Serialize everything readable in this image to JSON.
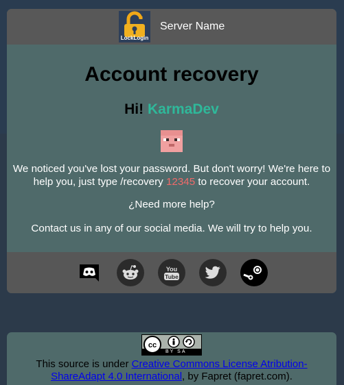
{
  "header": {
    "logo_text": "LockLogin",
    "server_name": "Server Name"
  },
  "main": {
    "title": "Account recovery",
    "greeting": "Hi!",
    "username": "KarmaDev",
    "message_part1": "We noticed you've lost your password. But don't worry! We're here to help you, just type /recovery ",
    "recovery_code": "12345",
    "message_part2": " to recover your account.",
    "help_text": "¿Need more help?",
    "contact_text": "Contact us in any of our social media. We will try to help you."
  },
  "social": [
    {
      "name": "discord-icon"
    },
    {
      "name": "reddit-icon"
    },
    {
      "name": "youtube-icon"
    },
    {
      "name": "twitter-icon"
    },
    {
      "name": "steam-icon"
    }
  ],
  "footer": {
    "license_badge": "BY SA",
    "text_before": "This source is under ",
    "link_text": "Creative Commons License Atribution-ShareAdapt 4.0 International",
    "text_after": ", by Fapret (fapret.com)."
  },
  "colors": {
    "card": "#4f6a6a",
    "header": "#585858",
    "accent_name": "#2fb89a",
    "code": "#f06a6a"
  }
}
